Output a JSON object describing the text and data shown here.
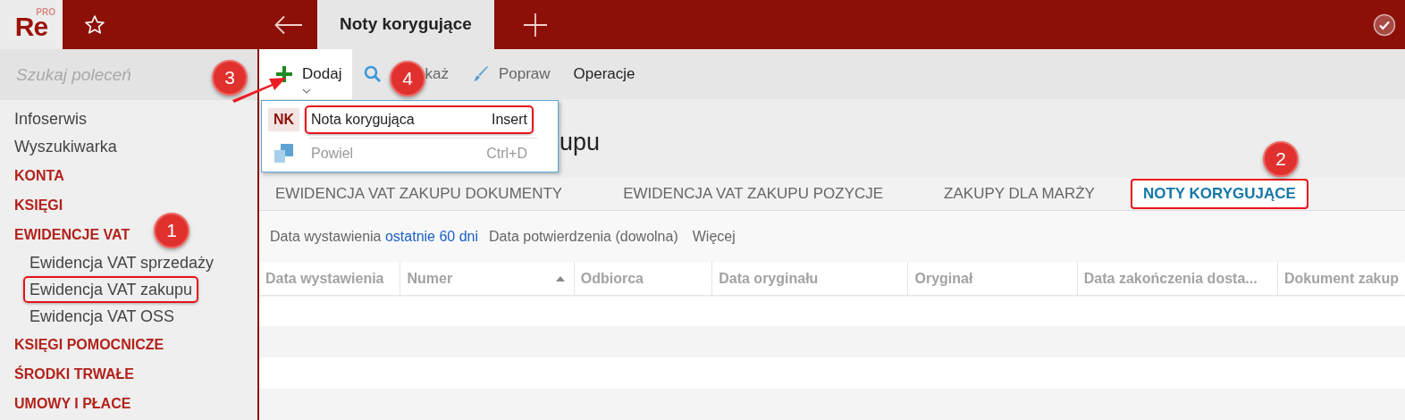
{
  "app": {
    "logo": "Re",
    "logo_badge": "PRO"
  },
  "tabs": [
    {
      "label": "Noty korygujące",
      "selected": true
    }
  ],
  "sidebar": {
    "search_placeholder": "Szukaj poleceń",
    "items": [
      {
        "label": "Infoserwis",
        "kind": "link"
      },
      {
        "label": "Wyszukiwarka",
        "kind": "link"
      },
      {
        "label": "KONTA",
        "kind": "section"
      },
      {
        "label": "KSIĘGI",
        "kind": "section"
      },
      {
        "label": "EWIDENCJE VAT",
        "kind": "section",
        "children": [
          {
            "label": "Ewidencja VAT sprzedaży",
            "highlighted": false
          },
          {
            "label": "Ewidencja VAT zakupu",
            "highlighted": true
          },
          {
            "label": "Ewidencja VAT OSS",
            "highlighted": false
          }
        ]
      },
      {
        "label": "KSIĘGI POMOCNICZE",
        "kind": "section"
      },
      {
        "label": "ŚRODKI TRWAŁE",
        "kind": "section"
      },
      {
        "label": "UMOWY I PŁACE",
        "kind": "section"
      }
    ]
  },
  "toolbar": [
    {
      "label": "Dodaj",
      "kind": "plus",
      "expanded": true
    },
    {
      "label": "każ",
      "kind": "search",
      "expanded": false
    },
    {
      "label": "Popraw",
      "kind": "brush",
      "expanded": false
    },
    {
      "label": "Operacje",
      "kind": "text",
      "expanded": false
    }
  ],
  "menu": [
    {
      "kind": "badge",
      "badge": "NK",
      "label": "Nota korygująca",
      "shortcut": "Insert",
      "disabled": false,
      "highlighted": true
    },
    {
      "kind": "copy",
      "label": "Powiel",
      "shortcut": "Ctrl+D",
      "disabled": true,
      "highlighted": false
    }
  ],
  "page_title": "upu",
  "view_tabs": [
    {
      "label": "EWIDENCJA VAT ZAKUPU DOKUMENTY",
      "selected": false,
      "highlighted": false
    },
    {
      "label": "EWIDENCJA VAT ZAKUPU POZYCJE",
      "selected": false,
      "highlighted": false
    },
    {
      "label": "ZAKUPY DLA MARŻY",
      "selected": false,
      "highlighted": false
    },
    {
      "label": "NOTY KORYGUJĄCE",
      "selected": true,
      "highlighted": true
    }
  ],
  "filters": [
    {
      "label": "Data wystawienia",
      "value": "ostatnie 60 dni",
      "active": true
    },
    {
      "label": "Data potwierdzenia",
      "value": "(dowolna)",
      "active": false
    }
  ],
  "more": "Więcej",
  "table": {
    "columns": [
      {
        "label": "Data wystawienia"
      },
      {
        "label": "Numer",
        "sorted": true
      },
      {
        "label": "Odbiorca"
      },
      {
        "label": "Data oryginału"
      },
      {
        "label": "Oryginał"
      },
      {
        "label": "Data zakończenia dosta..."
      },
      {
        "label": "Dokument zakup"
      }
    ]
  },
  "callouts": [
    {
      "label": "1"
    },
    {
      "label": "2"
    },
    {
      "label": "3"
    },
    {
      "label": "4"
    }
  ]
}
